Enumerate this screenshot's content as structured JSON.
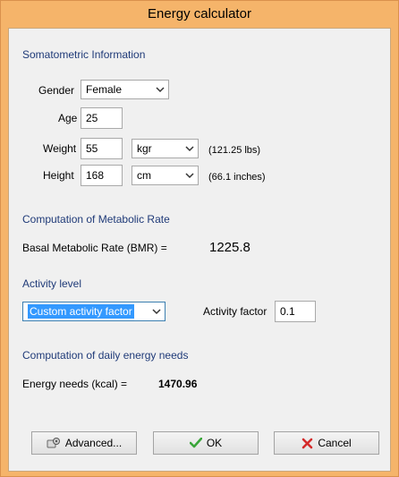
{
  "window": {
    "title": "Energy calculator"
  },
  "somatometric": {
    "heading": "Somatometric Information",
    "gender_label": "Gender",
    "gender_value": "Female",
    "age_label": "Age",
    "age_value": "25",
    "weight_label": "Weight",
    "weight_value": "55",
    "weight_unit": "kgr",
    "weight_converted": "(121.25 lbs)",
    "height_label": "Height",
    "height_value": "168",
    "height_unit": "cm",
    "height_converted": "(66.1 inches)"
  },
  "metabolic": {
    "heading": "Computation of Metabolic Rate",
    "bmr_label": "Basal Metabolic Rate (BMR) =",
    "bmr_value": "1225.8"
  },
  "activity": {
    "heading": "Activity level",
    "level_value": "Custom activity factor",
    "factor_label": "Activity factor",
    "factor_value": "0.1"
  },
  "energy": {
    "heading": "Computation of daily energy needs",
    "needs_label": "Energy needs (kcal) =",
    "needs_value": "1470.96"
  },
  "buttons": {
    "advanced": "Advanced...",
    "ok": "OK",
    "cancel": "Cancel"
  },
  "icons": {
    "advanced": "settings-gear-icon",
    "ok": "green-checkmark-icon",
    "cancel": "red-x-icon",
    "dropdown": "chevron-down-icon"
  },
  "colors": {
    "title_bar": "#f5b46a",
    "section_heading": "#1f3a78",
    "selection_highlight": "#3399ff",
    "ok_check": "#3aa63a",
    "cancel_x": "#d42a2a"
  }
}
